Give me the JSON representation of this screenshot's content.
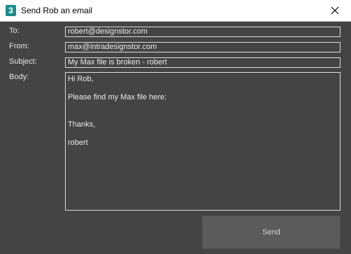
{
  "window": {
    "title": "Send Rob an email",
    "app_icon_glyph": "3",
    "app_icon_name": "3ds-max-icon",
    "close_icon": "close-icon"
  },
  "form": {
    "to_label": "To:",
    "to_value": "robert@designstor.com",
    "from_label": "From:",
    "from_value": "max@intradesignstor.com",
    "subject_label": "Subject:",
    "subject_value": "My Max file is broken - robert",
    "body_label": "Body:",
    "body_lines": [
      "Hi Rob,",
      "",
      "Please find my Max file here:",
      "",
      "",
      "Thanks,",
      "",
      "robert"
    ]
  },
  "actions": {
    "send_label": "Send"
  },
  "colors": {
    "background": "#444444",
    "titlebar": "#ffffff",
    "app_icon": "#1a8c8c",
    "field_border": "#dcdcdc",
    "button": "#5b5b5b"
  }
}
